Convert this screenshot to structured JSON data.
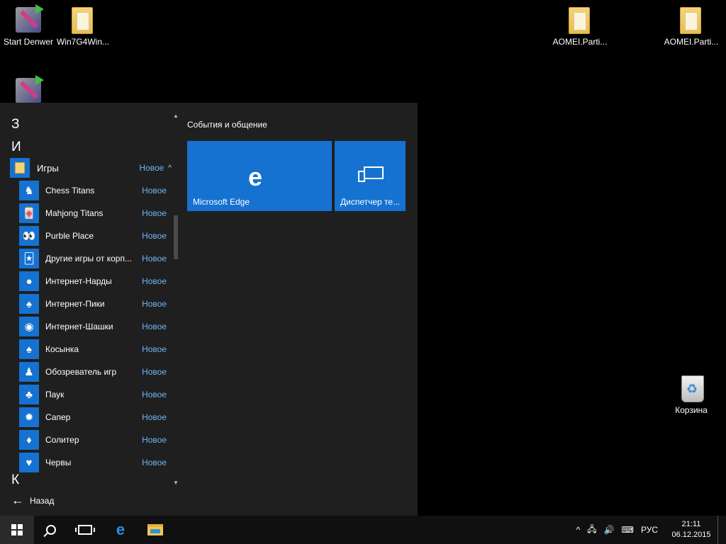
{
  "desktop": {
    "icons": [
      {
        "label": "Start Denwer"
      },
      {
        "label": "Win7G4Win..."
      },
      {
        "label": "AOMEI.Parti..."
      },
      {
        "label": "AOMEI.Parti..."
      },
      {
        "label": "Корзина"
      }
    ]
  },
  "start_menu": {
    "letters": [
      "З",
      "И",
      "К"
    ],
    "group": {
      "name": "Игры",
      "badge": "Новое",
      "caret": "^"
    },
    "apps": [
      {
        "name": "Chess Titans",
        "badge": "Новое",
        "icon": "chess-icon",
        "glyph": "♞"
      },
      {
        "name": "Mahjong Titans",
        "badge": "Новое",
        "icon": "mahjong-icon",
        "glyph": "🀄"
      },
      {
        "name": "Purble Place",
        "badge": "Новое",
        "icon": "purble-icon",
        "glyph": "👀"
      },
      {
        "name": "Другие игры от корп...",
        "badge": "Новое",
        "icon": "more-games-icon",
        "glyph": "🃏"
      },
      {
        "name": "Интернет-Нарды",
        "badge": "Новое",
        "icon": "backgammon-icon",
        "glyph": "●"
      },
      {
        "name": "Интернет-Пики",
        "badge": "Новое",
        "icon": "spades-icon",
        "glyph": "♠"
      },
      {
        "name": "Интернет-Шашки",
        "badge": "Новое",
        "icon": "checkers-icon",
        "glyph": "◉"
      },
      {
        "name": "Косынка",
        "badge": "Новое",
        "icon": "solitaire-icon",
        "glyph": "♠"
      },
      {
        "name": "Обозреватель игр",
        "badge": "Новое",
        "icon": "game-explorer-icon",
        "glyph": "♟"
      },
      {
        "name": "Паук",
        "badge": "Новое",
        "icon": "spider-icon",
        "glyph": "♣"
      },
      {
        "name": "Сапер",
        "badge": "Новое",
        "icon": "minesweeper-icon",
        "glyph": "✹"
      },
      {
        "name": "Солитер",
        "badge": "Новое",
        "icon": "freecell-icon",
        "glyph": "♦"
      },
      {
        "name": "Червы",
        "badge": "Новое",
        "icon": "hearts-icon",
        "glyph": "♥"
      }
    ],
    "back_label": "Назад",
    "back_glyph": "←",
    "tiles_title": "События и общение",
    "tiles": [
      {
        "label": "Microsoft Edge",
        "glyph": "e"
      },
      {
        "label": "Диспетчер те..."
      }
    ]
  },
  "taskbar": {
    "edge_glyph": "e",
    "tray": {
      "chevron": "^",
      "network": "🖧",
      "volume": "🔊",
      "keyboard": "⌨",
      "language": "РУС",
      "time": "21:11",
      "date": "06.12.2015"
    }
  },
  "colors": {
    "accent": "#1572d0",
    "badge": "#6fb3f5",
    "menu_bg": "#1f1f1f"
  }
}
